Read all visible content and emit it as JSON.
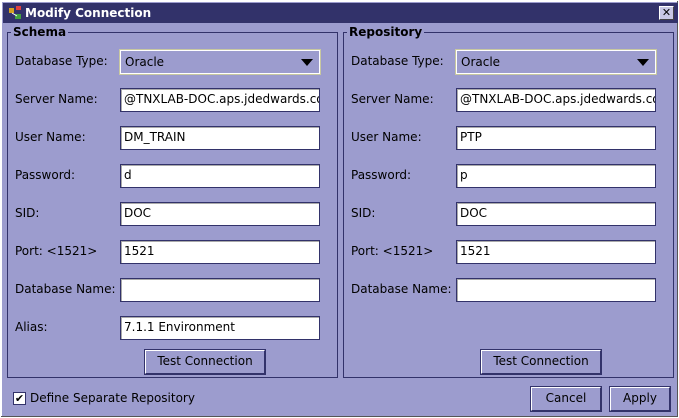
{
  "window": {
    "title": "Modify Connection"
  },
  "schema": {
    "title": "Schema",
    "database_type_label": "Database Type:",
    "database_type_value": "Oracle",
    "server_name_label": "Server Name:",
    "server_name_value": "@TNXLAB-DOC.aps.jdedwards.com",
    "user_name_label": "User Name:",
    "user_name_value": "DM_TRAIN",
    "password_label": "Password:",
    "password_value": "d",
    "sid_label": "SID:",
    "sid_value": "DOC",
    "port_label": "Port: <1521>",
    "port_value": "1521",
    "database_name_label": "Database Name:",
    "database_name_value": "",
    "alias_label": "Alias:",
    "alias_value": "7.1.1 Environment",
    "test_button": "Test Connection"
  },
  "repository": {
    "title": "Repository",
    "database_type_label": "Database Type:",
    "database_type_value": "Oracle",
    "server_name_label": "Server Name:",
    "server_name_value": "@TNXLAB-DOC.aps.jdedwards.com",
    "user_name_label": "User Name:",
    "user_name_value": "PTP",
    "password_label": "Password:",
    "password_value": "p",
    "sid_label": "SID:",
    "sid_value": "DOC",
    "port_label": "Port: <1521>",
    "port_value": "1521",
    "database_name_label": "Database Name:",
    "database_name_value": "",
    "test_button": "Test Connection"
  },
  "footer": {
    "define_separate_label": "Define Separate Repository",
    "define_separate_checked": true,
    "cancel_button": "Cancel",
    "apply_button": "Apply"
  },
  "colors": {
    "background": "#9c9cce",
    "titlebar": "#32326a"
  },
  "icons": {
    "app": "connection-app-icon",
    "close": "close-icon",
    "check": "check-icon"
  }
}
